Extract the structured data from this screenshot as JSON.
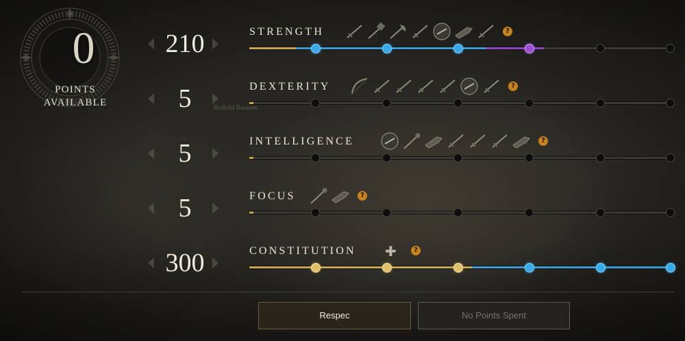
{
  "points": {
    "value": "0",
    "label_line1": "POINTS",
    "label_line2": "AVAILABLE"
  },
  "background_text": "Redbold Bananen",
  "attributes": [
    {
      "name": "STRENGTH",
      "value": "210",
      "gold_fill_fraction": 0.11,
      "tier_fill_fraction": 0.7,
      "fill_colors": [
        "#c7a64f",
        "#3d9bd4",
        "#8e45c4"
      ],
      "nodes": [
        "blue",
        "blue",
        "blue",
        "purple",
        "empty",
        "empty"
      ],
      "weapon_icons": [
        "sword-icon",
        "war-hammer-icon",
        "great-axe-icon",
        "hatchet-icon",
        "shield-icon",
        "blunderbuss-icon",
        "spear-icon"
      ],
      "help_icon": "?"
    },
    {
      "name": "DEXTERITY",
      "value": "5",
      "gold_fill_fraction": 0.01,
      "tier_fill_fraction": 0,
      "fill_colors": [
        "#c7a64f"
      ],
      "nodes": [
        "empty",
        "empty",
        "empty",
        "empty",
        "empty",
        "empty"
      ],
      "weapon_icons": [
        "bow-icon",
        "rapier-icon",
        "musket-icon",
        "spear-icon",
        "sword-icon",
        "shield-icon",
        "hatchet-icon"
      ],
      "help_icon": "?"
    },
    {
      "name": "INTELLIGENCE",
      "value": "5",
      "gold_fill_fraction": 0.01,
      "tier_fill_fraction": 0,
      "fill_colors": [
        "#c7a64f"
      ],
      "nodes": [
        "empty",
        "empty",
        "empty",
        "empty",
        "empty",
        "empty"
      ],
      "weapon_icons": [
        "gauntlet-icon",
        "fire-staff-icon",
        "blunderbuss-icon",
        "rapier-icon",
        "spear-icon",
        "musket-icon",
        "void-gauntlet-icon"
      ],
      "help_icon": "?"
    },
    {
      "name": "FOCUS",
      "value": "5",
      "gold_fill_fraction": 0.01,
      "tier_fill_fraction": 0,
      "fill_colors": [
        "#c7a64f"
      ],
      "nodes": [
        "empty",
        "empty",
        "empty",
        "empty",
        "empty",
        "empty"
      ],
      "weapon_icons": [
        "life-staff-icon",
        "ice-gauntlet-icon"
      ],
      "help_icon": "?"
    },
    {
      "name": "CONSTITUTION",
      "value": "300",
      "gold_fill_fraction": 0.53,
      "tier_fill_fraction": 1.0,
      "fill_colors": [
        "#c7a64f",
        "#3d9bd4"
      ],
      "nodes": [
        "gold",
        "gold",
        "gold",
        "blue",
        "blue",
        "blue"
      ],
      "weapon_icons": [],
      "plus_icon": "✚",
      "help_icon": "?"
    }
  ],
  "buttons": {
    "respec": "Respec",
    "no_points": "No Points Spent"
  }
}
